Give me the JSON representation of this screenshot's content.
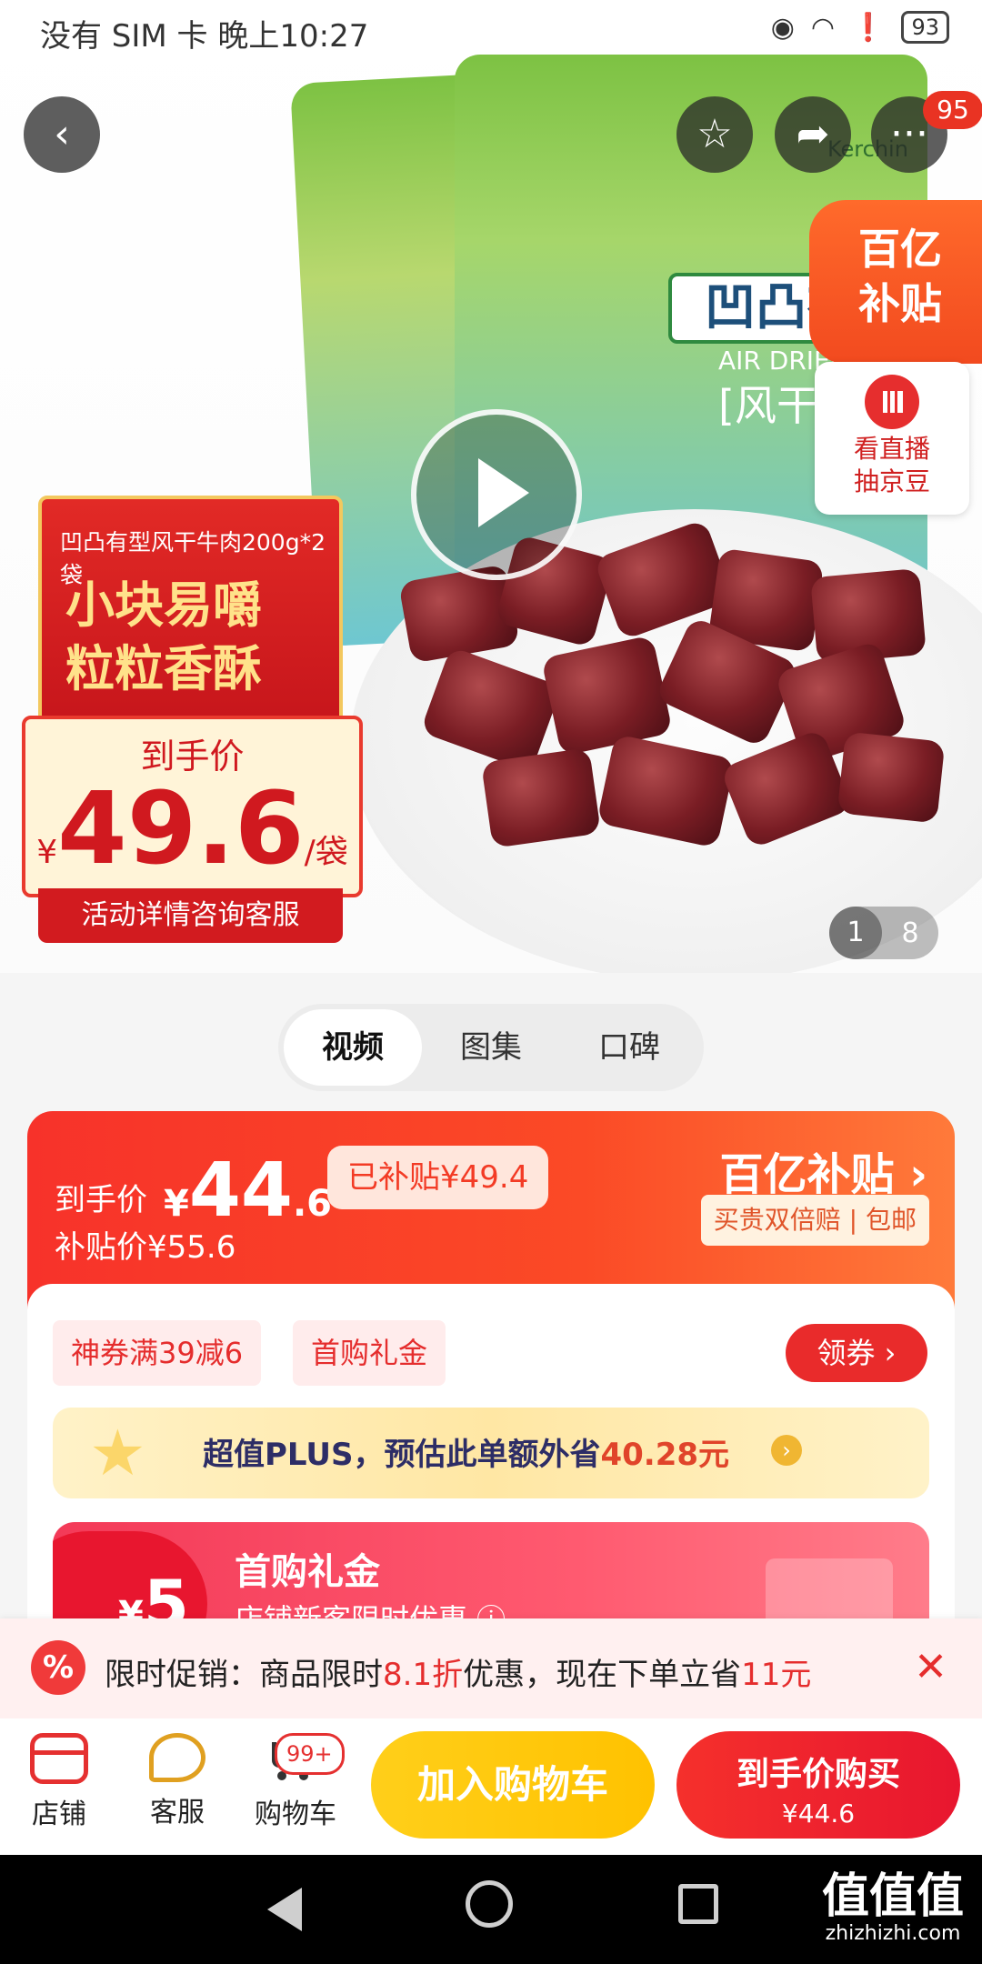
{
  "status_bar": {
    "left_text": "没有 SIM 卡 晚上10:27",
    "battery": "93"
  },
  "hero": {
    "bag_brand": "Kerchin",
    "bag_title": "凹凸有",
    "bag_subtitle_en": "AIR DRIED BEEF",
    "bag_subtitle_cn": "[风干牛",
    "more_badge": "95",
    "yi_badge_line1": "百亿",
    "yi_badge_line2": "补贴",
    "live_line1": "看直播",
    "live_line2": "抽京豆",
    "promo": {
      "title": "凹凸有型风干牛肉200g*2袋",
      "slogan_line1": "小块易嚼",
      "slogan_line2": "粒粒香酥",
      "price_label": "到手价",
      "currency": "¥",
      "price": "49.6",
      "unit": "/袋",
      "footer": "活动详情咨询客服"
    },
    "indicator_current": "1",
    "indicator_total": "8"
  },
  "media_tabs": [
    "视频",
    "图集",
    "口碑"
  ],
  "price_card": {
    "label": "到手价",
    "currency": "¥",
    "price_int": "44",
    "price_dec": ".6",
    "subsidy_tag": "已补贴¥49.4",
    "subsidy_price": "补贴价¥55.6",
    "brand": "百亿补贴 ›",
    "guarantee": "买贵双倍赔 | 包邮"
  },
  "coupons": {
    "tag1": "神券满39减6",
    "tag2": "首购礼金",
    "get_button": "领券 ›"
  },
  "plus_bar": {
    "text_prefix": "超值PLUS，预估此单额外省",
    "amount": "40.28元"
  },
  "gift_card": {
    "currency": "¥",
    "amount": "5",
    "title": "首购礼金",
    "subtitle": "店铺新客限时优惠 ⓘ"
  },
  "limited_banner": {
    "icon": "%",
    "text1": "限时促销：商品限时",
    "discount": "8.1折",
    "text2": "优惠，现在下单立省",
    "save": "11元",
    "close": "✕"
  },
  "bottom_bar": {
    "store": "店铺",
    "service": "客服",
    "cart": "购物车",
    "cart_badge": "99+",
    "add_to_cart": "加入购物车",
    "buy_line1": "到手价购买",
    "buy_line2": "¥44.6"
  },
  "watermark": {
    "main": "值值值",
    "sub": "zhizhizhi.com"
  }
}
